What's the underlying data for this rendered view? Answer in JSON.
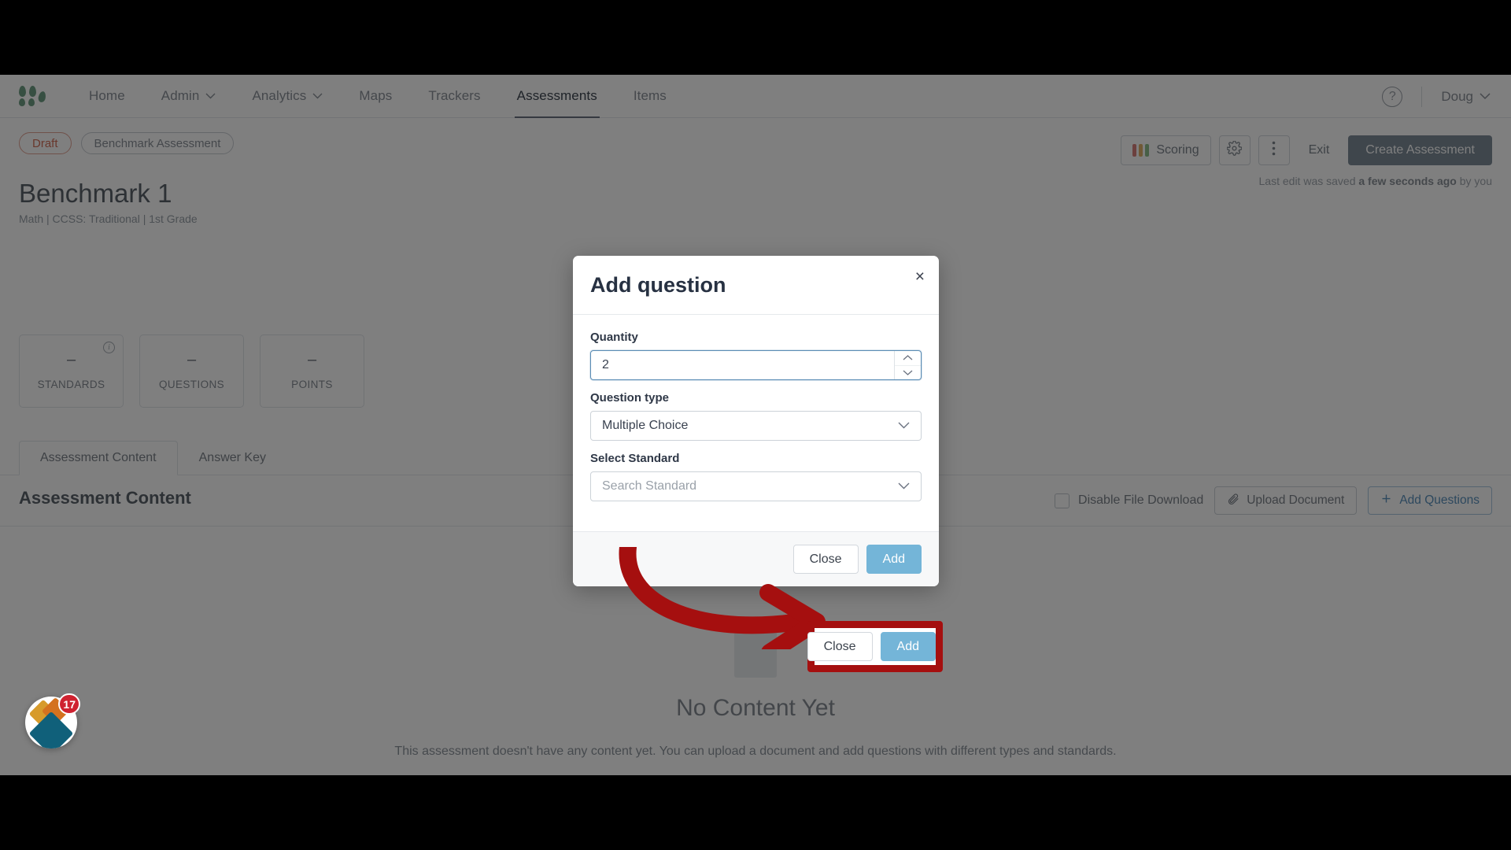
{
  "nav": {
    "logo": "organization-logo",
    "links": [
      {
        "label": "Home",
        "dropdown": false,
        "active": false
      },
      {
        "label": "Admin",
        "dropdown": true,
        "active": false
      },
      {
        "label": "Analytics",
        "dropdown": true,
        "active": false
      },
      {
        "label": "Maps",
        "dropdown": false,
        "active": false
      },
      {
        "label": "Trackers",
        "dropdown": false,
        "active": false
      },
      {
        "label": "Assessments",
        "dropdown": false,
        "active": true
      },
      {
        "label": "Items",
        "dropdown": false,
        "active": false
      }
    ],
    "help_icon": "help-circle-icon",
    "user": "Doug"
  },
  "header": {
    "status_pill": "Draft",
    "type_pill": "Benchmark Assessment",
    "title": "Benchmark 1",
    "subtitle": "Math  |  CCSS: Traditional  |  1st Grade",
    "saved_prefix": "Last edit was saved ",
    "saved_strong": "a few seconds ago",
    "saved_suffix": " by you"
  },
  "actions": {
    "scoring": "Scoring",
    "scoring_colors": [
      "#d9817c",
      "#e0b36a",
      "#8fbe8c"
    ],
    "settings_icon": "gear-icon",
    "more_icon": "kebab-menu-icon",
    "exit": "Exit",
    "create": "Create Assessment"
  },
  "stats": [
    {
      "value": "–",
      "label": "STANDARDS",
      "info": "info-icon"
    },
    {
      "value": "–",
      "label": "QUESTIONS",
      "info": null
    },
    {
      "value": "–",
      "label": "POINTS",
      "info": null
    }
  ],
  "tabs": [
    {
      "label": "Assessment Content",
      "active": true
    },
    {
      "label": "Answer Key",
      "active": false
    }
  ],
  "content": {
    "heading": "Assessment Content",
    "disable_file_download": "Disable File Download",
    "upload_document": "Upload Document",
    "upload_icon": "paperclip-icon",
    "add_questions": "Add Questions",
    "add_icon": "plus-icon"
  },
  "empty_state": {
    "title": "No Content Yet",
    "description": "This assessment doesn't have any content yet. You can upload a document and add questions with different types and standards."
  },
  "widget": {
    "name": "notifications-widget",
    "badge_count": "17"
  },
  "modal": {
    "title": "Add question",
    "close_icon": "close-icon",
    "fields": [
      {
        "label": "Quantity",
        "name": "quantity-stepper",
        "value": "2",
        "placeholder": "",
        "control": "spinner",
        "focused": true
      },
      {
        "label": "Question type",
        "name": "question-type-select",
        "value": "Multiple Choice",
        "placeholder": "",
        "control": "chevron",
        "focused": false
      },
      {
        "label": "Select Standard",
        "name": "select-standard-input",
        "value": "",
        "placeholder": "Search Standard",
        "control": "chevron",
        "focused": false
      }
    ],
    "close_button": "Close",
    "add_button": "Add"
  },
  "annotation": {
    "highlight_color": "#a50f0f",
    "arrow": "curved-arrow-pointing-right"
  },
  "colors": {
    "accent_blue": "#74b5d8",
    "draft_red": "#d2705a",
    "brand_green": "#6f9e84",
    "overlay": "rgba(0,0,0,0.5)"
  }
}
